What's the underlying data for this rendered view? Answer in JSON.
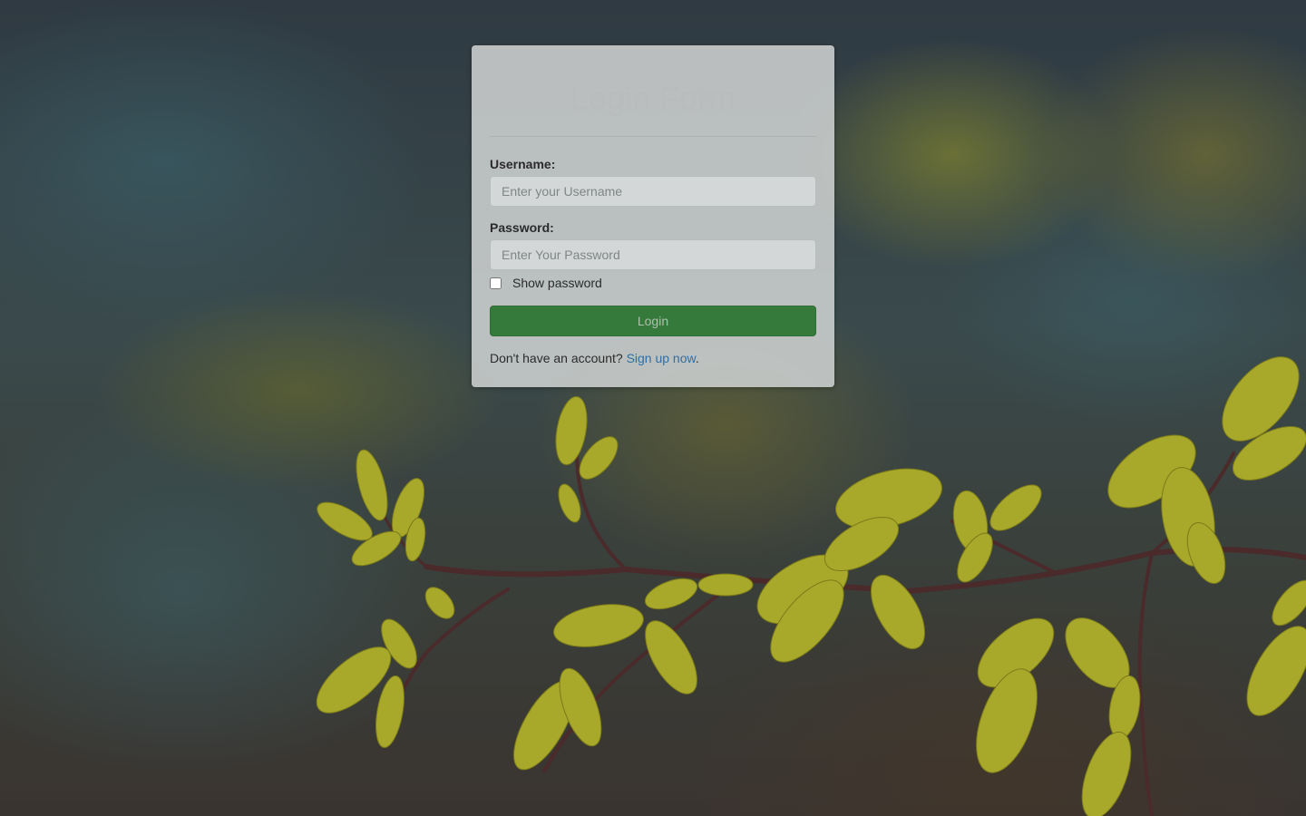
{
  "form": {
    "title": "Login Form",
    "username_label": "Username:",
    "username_placeholder": "Enter your Username",
    "password_label": "Password:",
    "password_placeholder": "Enter Your Password",
    "show_password_label": "Show password",
    "show_password_checked": false,
    "login_button": "Login",
    "signup_prompt": "Don't have an account? ",
    "signup_link": "Sign up now",
    "signup_suffix": "."
  },
  "colors": {
    "login_button": "#357a3b",
    "link": "#2f6ea6"
  }
}
